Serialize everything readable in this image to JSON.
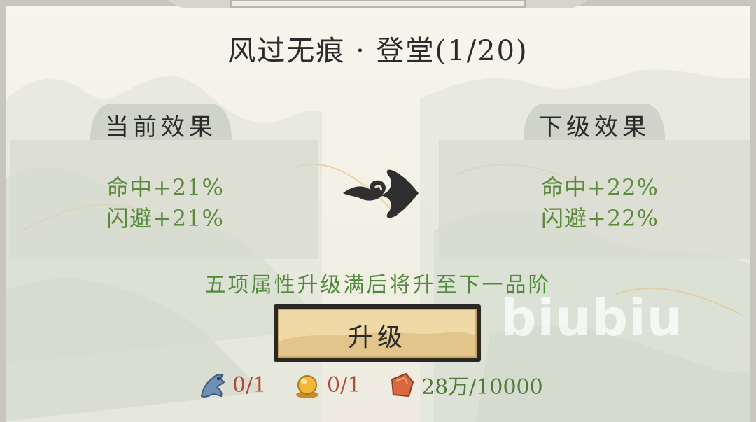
{
  "title": "风过无痕 · 登堂(1/20)",
  "current": {
    "label": "当前效果",
    "stats": [
      "命中+21%",
      "闪避+21%"
    ]
  },
  "next": {
    "label": "下级效果",
    "stats": [
      "命中+22%",
      "闪避+22%"
    ]
  },
  "hint": "五项属性升级满后将升至下一品阶",
  "upgrade_button": "升级",
  "watermark": "biubiu",
  "costs": [
    {
      "icon": "blue-dragon-material-icon",
      "text": "0/1",
      "color": "#b24a3a"
    },
    {
      "icon": "golden-pearl-icon",
      "text": "0/1",
      "color": "#b24a3a"
    },
    {
      "icon": "red-gem-currency-icon",
      "text": "28万/10000",
      "color": "#4f7a3a"
    }
  ],
  "colors": {
    "stat_text": "#5a8a3a",
    "hint_text": "#4f8a3a",
    "insufficient": "#b24a3a"
  }
}
